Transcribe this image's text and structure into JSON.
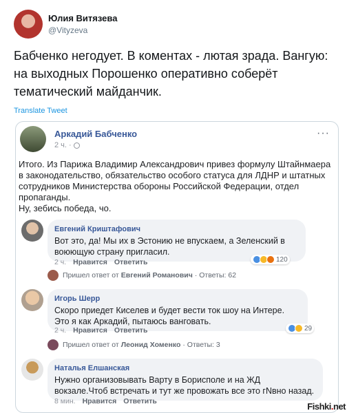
{
  "tweet": {
    "author_name": "Юлия Витязева",
    "handle": "@Vityzeva",
    "text": "Бабченко негодует. В коментах - лютая зрада. Вангую: на выходных Порошенко оперативно соберёт тематический майданчик.",
    "translate_label": "Translate Tweet"
  },
  "fb_post": {
    "author": "Аркадий Бабченко",
    "time": "2 ч. ·",
    "menu_label": "···",
    "text": "Итого. Из Парижа Владимир Александрович привез формулу Штайнмаера в законодательство, обязательство особого статуса для ЛДНР и штатных сотрудников Министерства обороны Российской Федерации, отдел пропаганды.\nНу, з​ебись победа, чо."
  },
  "comments": [
    {
      "name": "Евгений Криштафович",
      "text": "Вот это, да! Мы их в Эстонию не впускаем, а Зеленский в воюющую страну пригласил.",
      "time": "2 ч.",
      "like": "Нравится",
      "reply": "Ответить",
      "reactions_count": "120",
      "reply_prefix": "Пришел ответ от",
      "reply_author": "Евгений Романович",
      "reply_suffix": "· Ответы: 62"
    },
    {
      "name": "Игорь Шерр",
      "text": "Скоро приедет Киселев и будет вести ток шоу на Интере. Это я как Аркадий, пытаюсь вангова​ть.",
      "time": "2 ч.",
      "like": "Нравится",
      "reply": "Ответить",
      "reactions_count": "29",
      "reply_prefix": "Пришел ответ от",
      "reply_author": "Леонид Хоменко",
      "reply_suffix": "· Ответы: 3"
    },
    {
      "name": "Наталья Елшанская",
      "text": "Нужно организовывать Варту в Борисполе и на ЖД вокзале.Чтоб встречать и тут же провожать все это гΝвно назад.",
      "time": "8 мин.",
      "like": "Нравится",
      "reply": "Ответить"
    }
  ],
  "watermark": {
    "left": "Fishki",
    "dot": ".",
    "right": "net"
  },
  "colors": {
    "link_blue": "#385898",
    "twitter_blue": "#1b95e0",
    "bubble_bg": "#f0f2f5"
  }
}
